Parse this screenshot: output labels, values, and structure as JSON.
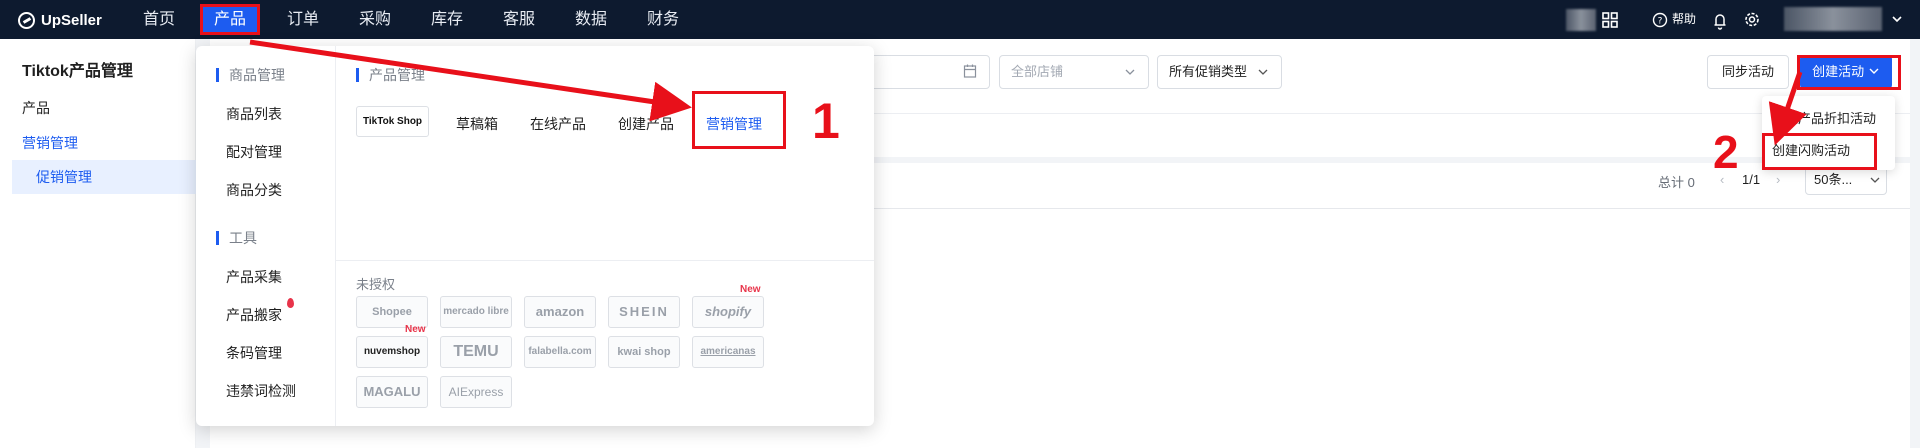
{
  "app": {
    "brand": "UpSeller"
  },
  "topnav": {
    "items": [
      "首页",
      "产品",
      "订单",
      "采购",
      "库存",
      "客服",
      "数据",
      "财务"
    ],
    "active_index": 1,
    "help_label": "帮助",
    "icons": [
      "grid-icon",
      "help-circle-icon",
      "bell-icon",
      "gear-icon",
      "chevron-down-icon"
    ]
  },
  "sidebar": {
    "title": "Tiktok产品管理",
    "items": [
      "产品",
      "营销管理"
    ],
    "active_parent": "营销管理",
    "sub_item": "促销管理"
  },
  "filters": {
    "shop_placeholder": "全部店铺",
    "promo_type": "所有促销类型",
    "sync_button": "同步活动",
    "create_button": "创建活动"
  },
  "create_menu": {
    "items": [
      "创建产品折扣活动",
      "创建闪购活动"
    ]
  },
  "pager": {
    "total": "总计 0",
    "page": "1/1",
    "page_size": "50条..."
  },
  "panel": {
    "goods_head": "商品管理",
    "goods_items": [
      "商品列表",
      "配对管理",
      "商品分类"
    ],
    "tools_head": "工具",
    "tools_items": [
      "产品采集",
      "产品搬家",
      "条码管理",
      "违禁词检测"
    ],
    "product_head": "产品管理",
    "platform_tag": "TikTok Shop",
    "product_menu": [
      "草稿箱",
      "在线产品",
      "创建产品",
      "营销管理"
    ],
    "unauth_label": "未授权",
    "platforms": [
      "Shopee",
      "mercado libre",
      "amazon",
      "SHEIN",
      "shopify",
      "nuvemshop",
      "TEMU",
      "falabella.com",
      "kwai shop",
      "americanas",
      "MAGALU",
      "AIExpress"
    ],
    "new_label": "New"
  },
  "annotations": {
    "step1": "1",
    "step2": "2"
  },
  "colors": {
    "nav_bg": "#0d1a2f",
    "accent": "#1d5cf0",
    "annotation_red": "#e8101a"
  }
}
